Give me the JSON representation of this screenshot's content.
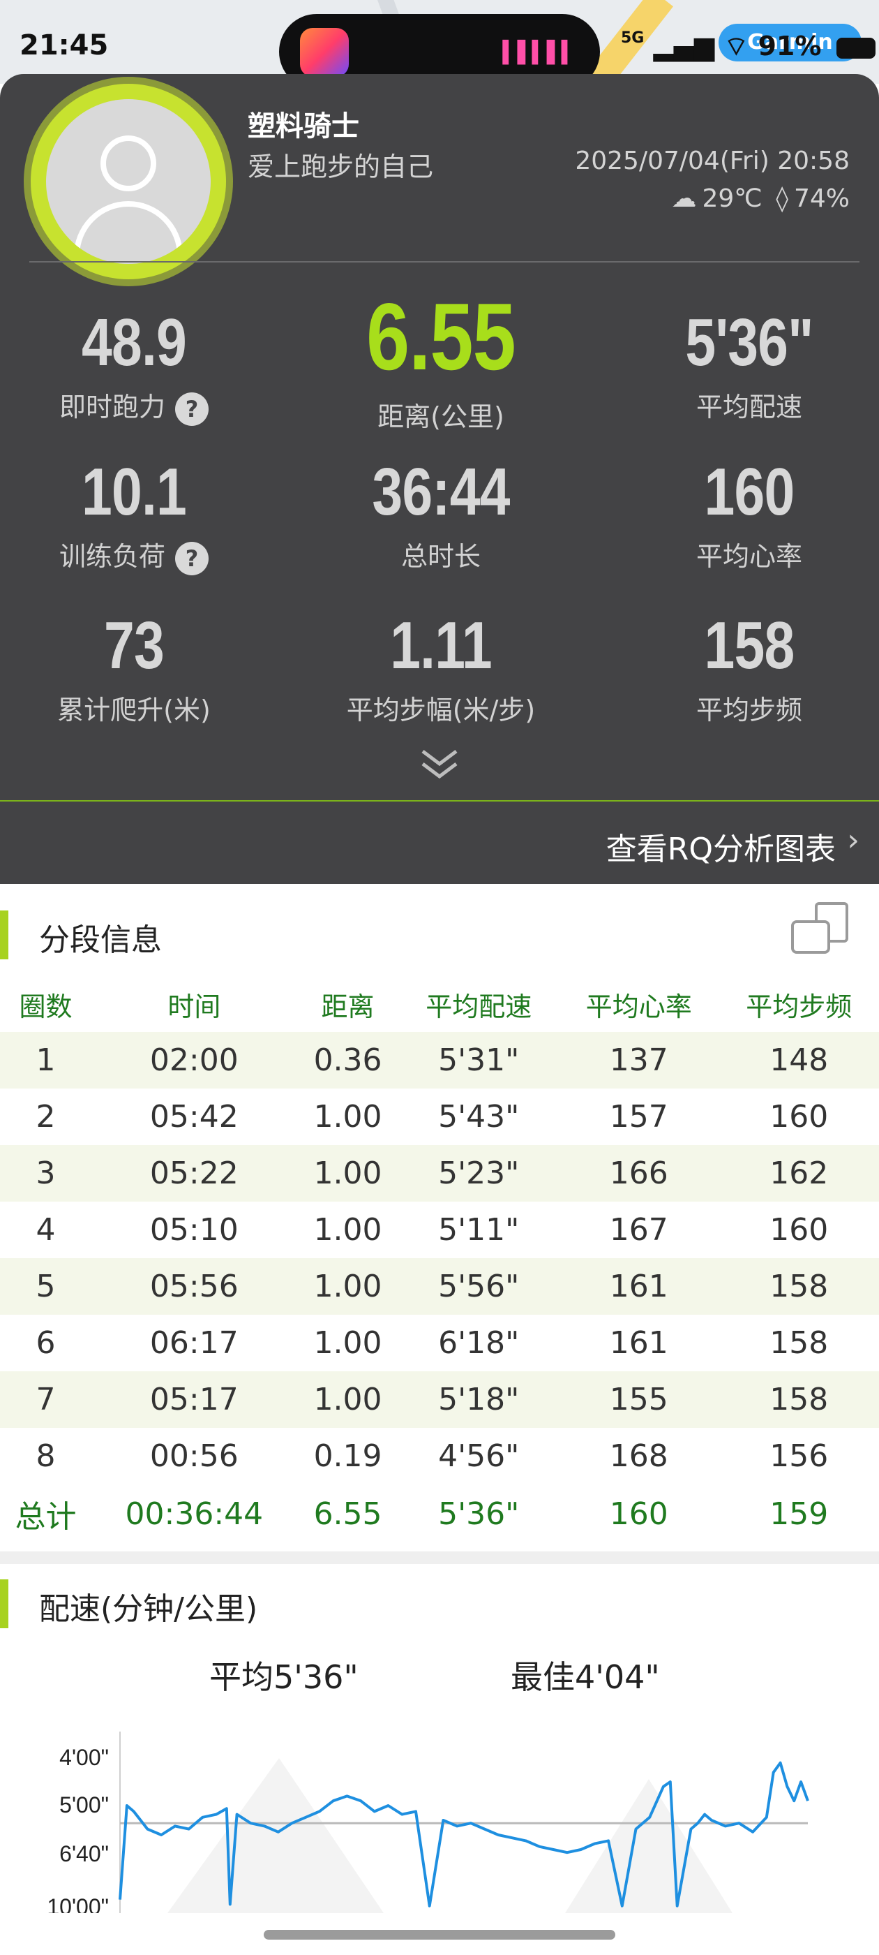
{
  "status_bar": {
    "time": "21:45",
    "time_prefix": "5",
    "network": "5G",
    "battery": "91%",
    "chip_label": "Garmin"
  },
  "profile": {
    "name": "塑料骑士",
    "motto": "爱上跑步的自己",
    "datetime": "2025/07/04(Fri) 20:58",
    "temperature": "29℃",
    "humidity": "74%"
  },
  "metrics": [
    {
      "value": "48.9",
      "label": "即时跑力",
      "help": true
    },
    {
      "value": "6.55",
      "label": "距离(公里)",
      "highlight": true
    },
    {
      "value": "5'36\"",
      "label": "平均配速"
    },
    {
      "value": "10.1",
      "label": "训练负荷",
      "help": true
    },
    {
      "value": "36:44",
      "label": "总时长"
    },
    {
      "value": "160",
      "label": "平均心率"
    },
    {
      "value": "73",
      "label": "累计爬升(米)"
    },
    {
      "value": "1.11",
      "label": "平均步幅(米/步)"
    },
    {
      "value": "158",
      "label": "平均步频"
    }
  ],
  "help_glyph": "?",
  "rq_link": {
    "label": "查看RQ分析图表",
    "arrow": "›"
  },
  "splits": {
    "title": "分段信息",
    "columns": [
      "圈数",
      "时间",
      "距离",
      "平均配速",
      "平均心率",
      "平均步频"
    ],
    "rows": [
      [
        "1",
        "02:00",
        "0.36",
        "5'31\"",
        "137",
        "148"
      ],
      [
        "2",
        "05:42",
        "1.00",
        "5'43\"",
        "157",
        "160"
      ],
      [
        "3",
        "05:22",
        "1.00",
        "5'23\"",
        "166",
        "162"
      ],
      [
        "4",
        "05:10",
        "1.00",
        "5'11\"",
        "167",
        "160"
      ],
      [
        "5",
        "05:56",
        "1.00",
        "5'56\"",
        "161",
        "158"
      ],
      [
        "6",
        "06:17",
        "1.00",
        "6'18\"",
        "161",
        "158"
      ],
      [
        "7",
        "05:17",
        "1.00",
        "5'18\"",
        "155",
        "158"
      ],
      [
        "8",
        "00:56",
        "0.19",
        "4'56\"",
        "168",
        "156"
      ]
    ],
    "total": [
      "总计",
      "00:36:44",
      "6.55",
      "5'36\"",
      "160",
      "159"
    ]
  },
  "pace": {
    "title": "配速(分钟/公里)",
    "avg_label": "平均5'36\"",
    "best_label": "最佳4'04\""
  },
  "chart_data": {
    "type": "line",
    "title": "配速(分钟/公里)",
    "y_ticks": [
      "4'00\"",
      "5'00\"",
      "6'40\"",
      "10'00\""
    ],
    "y_tick_minutes": [
      4.0,
      5.0,
      6.667,
      10.0
    ],
    "y_inverted": true,
    "average_line_minutes": 5.6,
    "series": [
      {
        "x_fraction": [
          0.0,
          0.01,
          0.02,
          0.04,
          0.06,
          0.08,
          0.1,
          0.12,
          0.14,
          0.155,
          0.16,
          0.17,
          0.19,
          0.21,
          0.23,
          0.25,
          0.27,
          0.29,
          0.31,
          0.33,
          0.35,
          0.37,
          0.39,
          0.41,
          0.43,
          0.45,
          0.47,
          0.49,
          0.51,
          0.53,
          0.55,
          0.57,
          0.59,
          0.61,
          0.63,
          0.65,
          0.67,
          0.69,
          0.71,
          0.73,
          0.75,
          0.77,
          0.79,
          0.8,
          0.81,
          0.83,
          0.84,
          0.85,
          0.86,
          0.88,
          0.9,
          0.92,
          0.94,
          0.95,
          0.96,
          0.97,
          0.98,
          0.99,
          1.0
        ],
        "pace_minutes": [
          9.5,
          5.0,
          5.2,
          5.8,
          6.0,
          5.7,
          5.8,
          5.4,
          5.3,
          5.1,
          9.8,
          5.3,
          5.6,
          5.7,
          5.9,
          5.6,
          5.4,
          5.2,
          4.9,
          4.8,
          4.9,
          5.2,
          5.0,
          5.3,
          5.2,
          9.9,
          5.5,
          5.7,
          5.6,
          5.8,
          6.0,
          6.1,
          6.2,
          6.4,
          6.5,
          6.6,
          6.5,
          6.3,
          6.2,
          9.9,
          5.8,
          5.4,
          4.6,
          4.5,
          9.9,
          5.8,
          5.6,
          5.3,
          5.5,
          5.7,
          5.6,
          5.9,
          5.4,
          4.3,
          4.1,
          4.6,
          4.9,
          4.5,
          4.9
        ]
      }
    ]
  }
}
